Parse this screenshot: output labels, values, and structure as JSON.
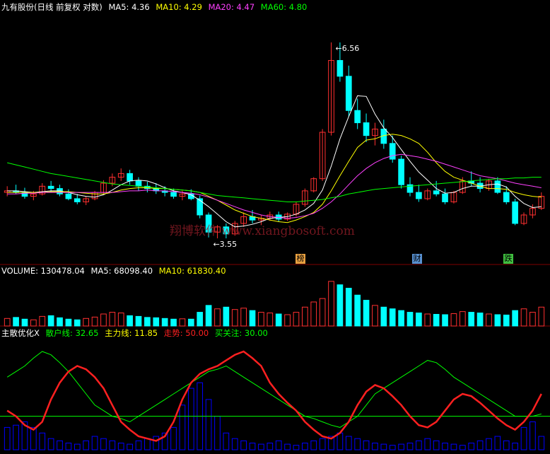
{
  "header": {
    "stock_label": "九有股份(日线 前复权 对数)",
    "ma": [
      {
        "label": "MA5: 4.36",
        "color": "#ffffff"
      },
      {
        "label": "MA10: 4.29",
        "color": "#ffff00"
      },
      {
        "label": "MA20: 4.47",
        "color": "#ff40ff"
      },
      {
        "label": "MA60: 4.80",
        "color": "#00ff00"
      }
    ]
  },
  "volume_header": {
    "label": "VOLUME: 130478.04",
    "ma5": "MA5: 68098.40",
    "ma10": "MA10: 61830.40"
  },
  "indicator_header": {
    "name": "主散优化X",
    "retail": "散户线: 32.65",
    "main": "主力线: 11.85",
    "trend": "走势: 50.00",
    "watch": "买关注: 30.00"
  },
  "watermark": "翔博软件 www.xiangbosoft.com",
  "annotations": {
    "high": "6.56",
    "low": "3.55"
  },
  "badges": [
    {
      "text": "榜",
      "color": "#e8a040"
    },
    {
      "text": "财",
      "color": "#5890d0"
    },
    {
      "text": "跌",
      "color": "#40c040"
    }
  ],
  "colors": {
    "up": "#ff3030",
    "down": "#00ffff",
    "ma5": "#ffffff",
    "ma10": "#ffff00",
    "ma20": "#ff40ff",
    "ma60": "#00ff00",
    "trend": "#ff2020",
    "retail": "#00ff00",
    "main": "#0000ff",
    "grid": "#800000"
  },
  "chart_data": {
    "type": "candlestick",
    "scale": "log",
    "ylim": [
      3.3,
      7.2
    ],
    "ohlc": [
      [
        4.1,
        4.18,
        4.05,
        4.12
      ],
      [
        4.12,
        4.2,
        4.08,
        4.1
      ],
      [
        4.1,
        4.16,
        4.02,
        4.05
      ],
      [
        4.05,
        4.12,
        4.0,
        4.08
      ],
      [
        4.08,
        4.22,
        4.06,
        4.18
      ],
      [
        4.18,
        4.25,
        4.1,
        4.15
      ],
      [
        4.15,
        4.2,
        4.05,
        4.08
      ],
      [
        4.08,
        4.14,
        4.0,
        4.02
      ],
      [
        4.02,
        4.08,
        3.95,
        3.98
      ],
      [
        3.98,
        4.05,
        3.94,
        4.02
      ],
      [
        4.02,
        4.12,
        4.0,
        4.1
      ],
      [
        4.1,
        4.26,
        4.08,
        4.22
      ],
      [
        4.22,
        4.35,
        4.18,
        4.3
      ],
      [
        4.3,
        4.42,
        4.25,
        4.35
      ],
      [
        4.35,
        4.4,
        4.2,
        4.25
      ],
      [
        4.25,
        4.3,
        4.12,
        4.18
      ],
      [
        4.18,
        4.24,
        4.1,
        4.15
      ],
      [
        4.15,
        4.22,
        4.08,
        4.12
      ],
      [
        4.12,
        4.18,
        4.05,
        4.1
      ],
      [
        4.1,
        4.15,
        4.02,
        4.05
      ],
      [
        4.05,
        4.12,
        4.0,
        4.08
      ],
      [
        4.08,
        4.14,
        4.0,
        4.02
      ],
      [
        4.02,
        4.06,
        3.78,
        3.82
      ],
      [
        3.82,
        3.85,
        3.56,
        3.62
      ],
      [
        3.62,
        3.7,
        3.55,
        3.68
      ],
      [
        3.68,
        3.72,
        3.55,
        3.6
      ],
      [
        3.6,
        3.75,
        3.58,
        3.72
      ],
      [
        3.72,
        3.85,
        3.68,
        3.8
      ],
      [
        3.8,
        3.88,
        3.72,
        3.76
      ],
      [
        3.76,
        3.82,
        3.7,
        3.78
      ],
      [
        3.78,
        3.86,
        3.75,
        3.82
      ],
      [
        3.82,
        3.86,
        3.74,
        3.77
      ],
      [
        3.77,
        3.85,
        3.75,
        3.83
      ],
      [
        3.83,
        3.98,
        3.8,
        3.95
      ],
      [
        3.95,
        4.15,
        3.92,
        4.12
      ],
      [
        4.12,
        4.3,
        4.1,
        4.28
      ],
      [
        4.28,
        5.0,
        4.25,
        4.95
      ],
      [
        4.95,
        6.56,
        4.9,
        6.2
      ],
      [
        6.2,
        6.56,
        5.8,
        5.9
      ],
      [
        5.9,
        6.1,
        5.2,
        5.3
      ],
      [
        5.3,
        5.5,
        5.0,
        5.1
      ],
      [
        5.1,
        5.25,
        4.8,
        4.9
      ],
      [
        4.9,
        5.1,
        4.75,
        5.0
      ],
      [
        5.0,
        5.15,
        4.7,
        4.78
      ],
      [
        4.78,
        4.9,
        4.5,
        4.55
      ],
      [
        4.55,
        4.6,
        4.15,
        4.2
      ],
      [
        4.2,
        4.3,
        4.05,
        4.1
      ],
      [
        4.1,
        4.2,
        3.98,
        4.02
      ],
      [
        4.02,
        4.15,
        4.0,
        4.12
      ],
      [
        4.12,
        4.25,
        4.05,
        4.08
      ],
      [
        4.08,
        4.15,
        3.95,
        3.98
      ],
      [
        3.98,
        4.12,
        3.96,
        4.1
      ],
      [
        4.1,
        4.3,
        4.08,
        4.25
      ],
      [
        4.25,
        4.38,
        4.18,
        4.22
      ],
      [
        4.22,
        4.3,
        4.1,
        4.15
      ],
      [
        4.15,
        4.28,
        4.12,
        4.25
      ],
      [
        4.25,
        4.3,
        4.08,
        4.1
      ],
      [
        4.1,
        4.18,
        3.95,
        3.98
      ],
      [
        3.98,
        4.02,
        3.7,
        3.72
      ],
      [
        3.72,
        3.85,
        3.7,
        3.82
      ],
      [
        3.82,
        3.95,
        3.78,
        3.9
      ],
      [
        3.9,
        4.1,
        3.88,
        4.05
      ]
    ],
    "ma_series": [
      {
        "name": "MA5",
        "values": [
          4.12,
          4.12,
          4.11,
          4.1,
          4.11,
          4.12,
          4.12,
          4.1,
          4.07,
          4.05,
          4.04,
          4.07,
          4.13,
          4.2,
          4.25,
          4.26,
          4.25,
          4.21,
          4.16,
          4.12,
          4.1,
          4.07,
          4.0,
          3.92,
          3.83,
          3.74,
          3.68,
          3.69,
          3.71,
          3.74,
          3.78,
          3.79,
          3.8,
          3.83,
          3.88,
          3.96,
          4.13,
          4.45,
          4.85,
          5.2,
          5.55,
          5.54,
          5.24,
          5.02,
          4.87,
          4.69,
          4.52,
          4.37,
          4.26,
          4.15,
          4.09,
          4.1,
          4.15,
          4.18,
          4.18,
          4.2,
          4.21,
          4.17,
          4.05,
          3.96,
          3.91,
          3.92
        ]
      },
      {
        "name": "MA10",
        "values": [
          4.1,
          4.1,
          4.1,
          4.1,
          4.1,
          4.11,
          4.11,
          4.11,
          4.1,
          4.09,
          4.08,
          4.08,
          4.1,
          4.13,
          4.15,
          4.16,
          4.16,
          4.15,
          4.15,
          4.14,
          4.13,
          4.12,
          4.1,
          4.05,
          4.0,
          3.94,
          3.88,
          3.84,
          3.8,
          3.78,
          3.76,
          3.74,
          3.73,
          3.76,
          3.8,
          3.85,
          3.95,
          4.12,
          4.32,
          4.52,
          4.72,
          4.83,
          4.85,
          4.9,
          4.92,
          4.9,
          4.85,
          4.78,
          4.65,
          4.5,
          4.38,
          4.3,
          4.26,
          4.22,
          4.18,
          4.15,
          4.15,
          4.14,
          4.1,
          4.07,
          4.05,
          4.04
        ]
      },
      {
        "name": "MA20",
        "values": [
          4.08,
          4.08,
          4.09,
          4.09,
          4.1,
          4.1,
          4.1,
          4.1,
          4.1,
          4.1,
          4.1,
          4.1,
          4.1,
          4.11,
          4.12,
          4.12,
          4.13,
          4.12,
          4.12,
          4.11,
          4.1,
          4.09,
          4.07,
          4.04,
          4.0,
          3.96,
          3.92,
          3.88,
          3.85,
          3.82,
          3.8,
          3.79,
          3.78,
          3.79,
          3.81,
          3.84,
          3.9,
          3.98,
          4.08,
          4.2,
          4.32,
          4.42,
          4.5,
          4.56,
          4.6,
          4.62,
          4.6,
          4.58,
          4.55,
          4.52,
          4.48,
          4.44,
          4.4,
          4.36,
          4.32,
          4.3,
          4.28,
          4.25,
          4.22,
          4.2,
          4.18,
          4.16
        ]
      },
      {
        "name": "MA60",
        "values": [
          4.5,
          4.47,
          4.44,
          4.41,
          4.38,
          4.35,
          4.33,
          4.31,
          4.29,
          4.27,
          4.25,
          4.23,
          4.21,
          4.2,
          4.19,
          4.18,
          4.17,
          4.16,
          4.15,
          4.14,
          4.13,
          4.12,
          4.1,
          4.08,
          4.06,
          4.05,
          4.04,
          4.03,
          4.02,
          4.01,
          4.0,
          3.99,
          3.98,
          3.98,
          3.99,
          4.0,
          4.01,
          4.03,
          4.05,
          4.08,
          4.1,
          4.12,
          4.14,
          4.15,
          4.16,
          4.17,
          4.18,
          4.19,
          4.2,
          4.21,
          4.22,
          4.23,
          4.24,
          4.25,
          4.26,
          4.27,
          4.28,
          4.28,
          4.29,
          4.29,
          4.3,
          4.3
        ]
      }
    ],
    "volume": [
      22,
      25,
      20,
      18,
      28,
      30,
      24,
      20,
      18,
      22,
      26,
      35,
      40,
      38,
      30,
      28,
      25,
      24,
      22,
      20,
      21,
      20,
      40,
      60,
      50,
      55,
      48,
      52,
      45,
      40,
      38,
      35,
      33,
      40,
      55,
      70,
      80,
      130,
      120,
      110,
      90,
      75,
      60,
      55,
      50,
      45,
      40,
      38,
      35,
      34,
      33,
      36,
      42,
      40,
      38,
      35,
      33,
      32,
      45,
      50,
      40,
      55
    ],
    "volume_max": 140,
    "indicator": {
      "ylim": [
        0,
        100
      ],
      "trend": [
        35,
        30,
        22,
        18,
        25,
        45,
        60,
        70,
        75,
        72,
        65,
        55,
        40,
        25,
        18,
        12,
        10,
        8,
        12,
        25,
        45,
        60,
        68,
        72,
        75,
        80,
        85,
        88,
        82,
        75,
        60,
        50,
        42,
        35,
        25,
        18,
        12,
        10,
        15,
        25,
        40,
        52,
        58,
        55,
        48,
        40,
        30,
        22,
        20,
        25,
        35,
        45,
        50,
        48,
        42,
        35,
        28,
        22,
        18,
        25,
        35,
        50
      ],
      "retail": [
        65,
        70,
        75,
        82,
        88,
        85,
        78,
        70,
        60,
        50,
        40,
        35,
        30,
        28,
        25,
        30,
        35,
        40,
        45,
        50,
        55,
        60,
        65,
        70,
        72,
        75,
        70,
        65,
        60,
        55,
        50,
        45,
        40,
        35,
        30,
        28,
        25,
        22,
        20,
        25,
        30,
        40,
        50,
        55,
        60,
        65,
        70,
        75,
        80,
        78,
        72,
        65,
        60,
        55,
        50,
        45,
        40,
        35,
        30,
        30,
        30,
        32
      ],
      "main": [
        20,
        22,
        25,
        20,
        15,
        10,
        8,
        6,
        5,
        8,
        12,
        10,
        8,
        6,
        5,
        8,
        10,
        12,
        15,
        20,
        40,
        55,
        60,
        45,
        30,
        15,
        10,
        8,
        6,
        5,
        6,
        8,
        5,
        4,
        6,
        8,
        10,
        12,
        15,
        12,
        10,
        8,
        6,
        5,
        4,
        5,
        6,
        8,
        10,
        8,
        6,
        5,
        4,
        6,
        8,
        10,
        12,
        8,
        6,
        20,
        25,
        12
      ]
    }
  }
}
